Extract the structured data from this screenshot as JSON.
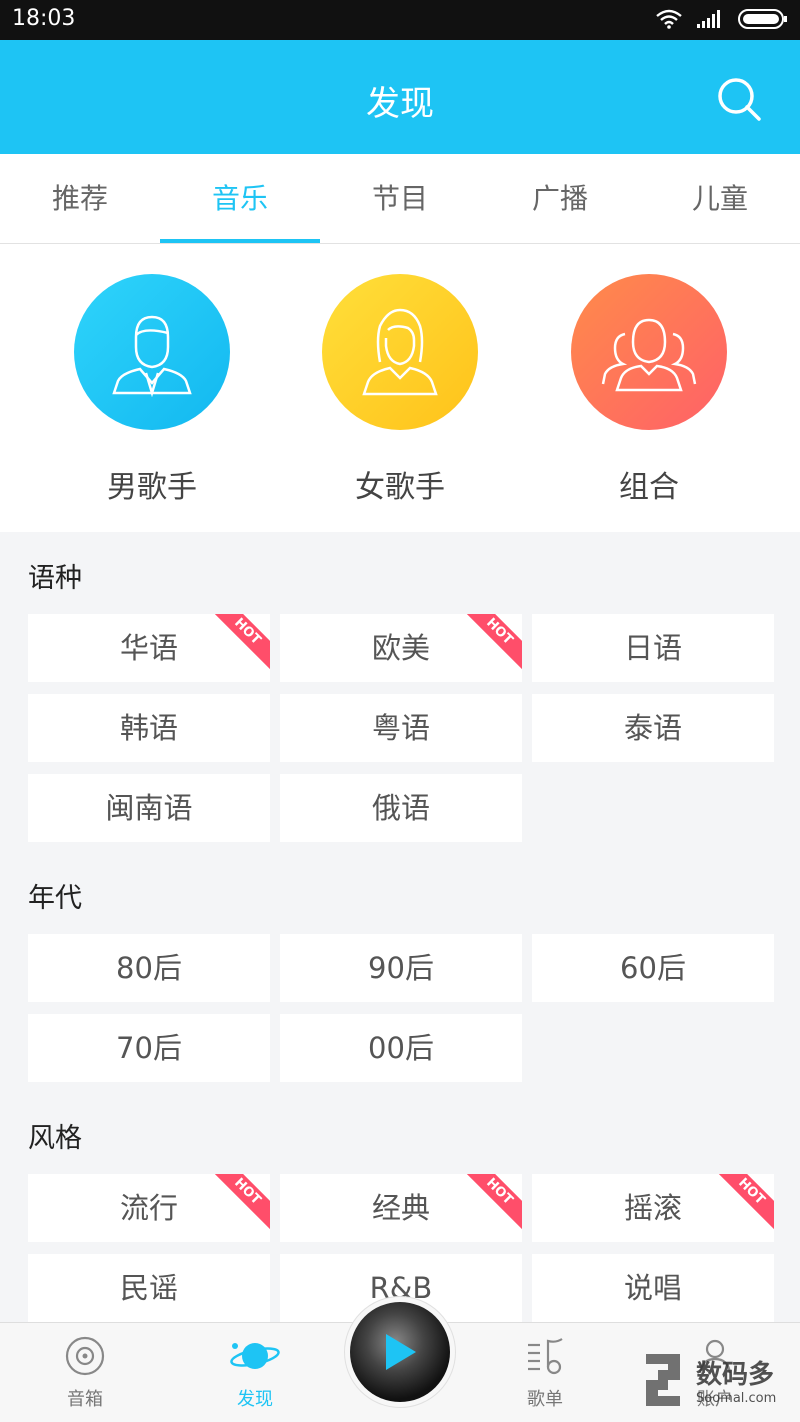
{
  "status_bar": {
    "time": "18:03"
  },
  "header": {
    "title": "发现"
  },
  "tabs": [
    {
      "label": "推荐",
      "active": false
    },
    {
      "label": "音乐",
      "active": true
    },
    {
      "label": "节目",
      "active": false
    },
    {
      "label": "广播",
      "active": false
    },
    {
      "label": "儿童",
      "active": false
    }
  ],
  "artists": [
    {
      "label": "男歌手",
      "icon": "male-singer-icon"
    },
    {
      "label": "女歌手",
      "icon": "female-singer-icon"
    },
    {
      "label": "组合",
      "icon": "group-icon"
    }
  ],
  "hot_badge": "HOT",
  "sections": {
    "language": {
      "title": "语种",
      "items": [
        {
          "label": "华语",
          "hot": true
        },
        {
          "label": "欧美",
          "hot": true
        },
        {
          "label": "日语",
          "hot": false
        },
        {
          "label": "韩语",
          "hot": false
        },
        {
          "label": "粤语",
          "hot": false
        },
        {
          "label": "泰语",
          "hot": false
        },
        {
          "label": "闽南语",
          "hot": false
        },
        {
          "label": "俄语",
          "hot": false
        }
      ]
    },
    "era": {
      "title": "年代",
      "items": [
        {
          "label": "80后"
        },
        {
          "label": "90后"
        },
        {
          "label": "60后"
        },
        {
          "label": "70后"
        },
        {
          "label": "00后"
        }
      ]
    },
    "style": {
      "title": "风格",
      "items": [
        {
          "label": "流行",
          "hot": true
        },
        {
          "label": "经典",
          "hot": true
        },
        {
          "label": "摇滚",
          "hot": true
        },
        {
          "label": "民谣",
          "hot": false
        },
        {
          "label": "R&B",
          "hot": false
        },
        {
          "label": "说唱",
          "hot": false
        }
      ]
    }
  },
  "bottom_nav": [
    {
      "label": "音箱",
      "icon": "speaker-icon",
      "active": false
    },
    {
      "label": "发现",
      "icon": "planet-icon",
      "active": true
    },
    {
      "label": "歌单",
      "icon": "playlist-icon",
      "active": false
    },
    {
      "label": "账户",
      "icon": "account-icon",
      "active": false
    }
  ],
  "watermark": {
    "brand_cn": "数码多",
    "brand_en": "Soomal.com"
  },
  "colors": {
    "accent": "#1ec4f4",
    "hot": "#ff4e6a"
  }
}
